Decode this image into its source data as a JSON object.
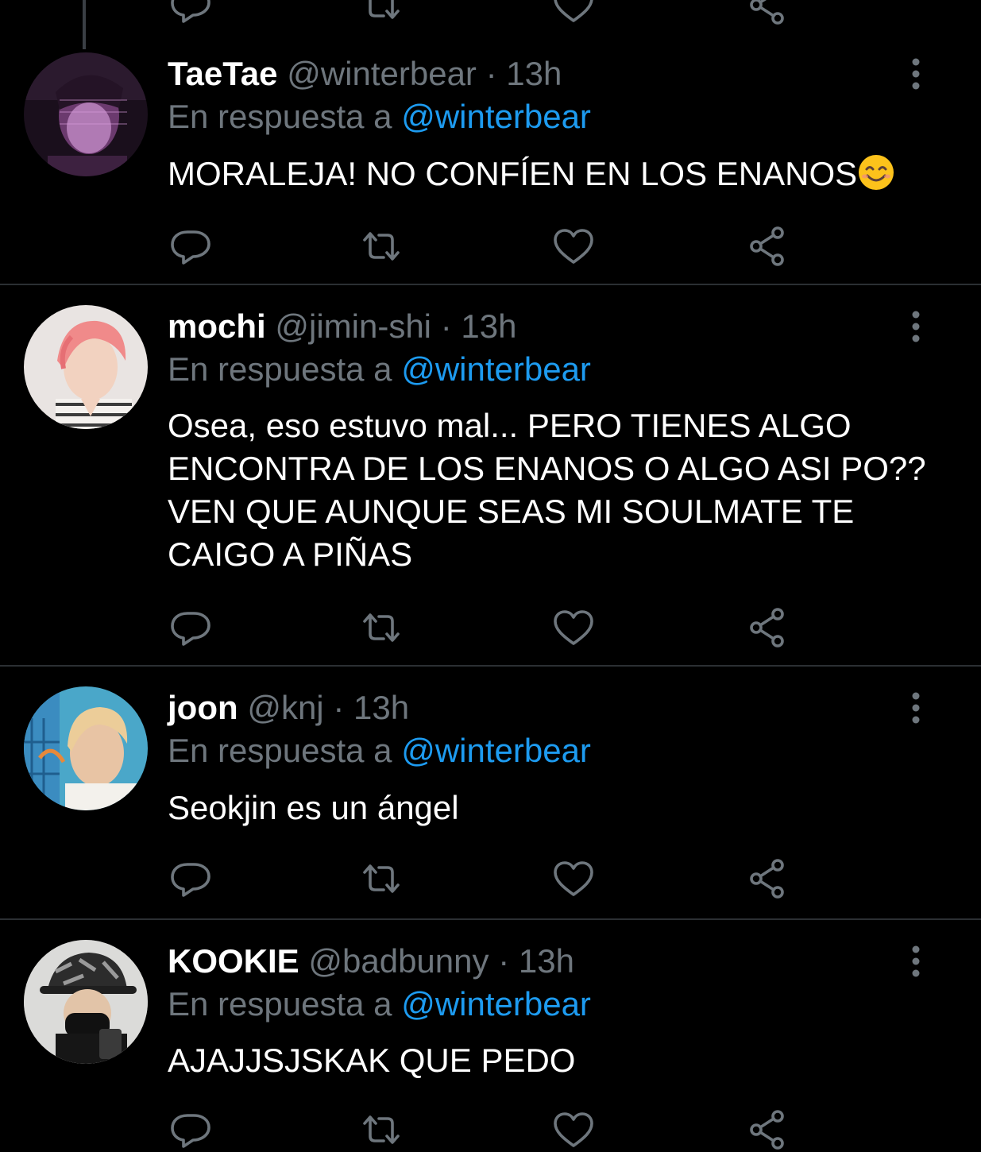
{
  "colors": {
    "background": "#000000",
    "text": "#ffffff",
    "muted": "#6e767d",
    "accent": "#1d9bf0",
    "divider": "#2b2f33"
  },
  "reply_prefix": "En respuesta a",
  "tweets": [
    {
      "display_name": "TaeTae",
      "handle": "@winterbear",
      "separator": "·",
      "time": "13h",
      "reply_to": "@winterbear",
      "text": "MORALEJA! NO CONFÍEN EN LOS ENANOS",
      "emoji": "smiling-face-emoji",
      "avatar": "avatar-purple-portrait"
    },
    {
      "display_name": "mochi",
      "handle": "@jimin-shi",
      "separator": "·",
      "time": "13h",
      "reply_to": "@winterbear",
      "text": "Osea, eso estuvo mal... PERO TIENES ALGO ENCONTRA DE LOS ENANOS O ALGO ASI PO?? VEN QUE AUNQUE SEAS MI SOULMATE TE CAIGO A PIÑAS",
      "avatar": "avatar-pink-hair-portrait"
    },
    {
      "display_name": "joon",
      "handle": "@knj",
      "separator": "·",
      "time": "13h",
      "reply_to": "@winterbear",
      "text": "Seokjin es un ángel",
      "avatar": "avatar-blond-portrait"
    },
    {
      "display_name": "KOOKIE",
      "handle": "@badbunny",
      "separator": "·",
      "time": "13h",
      "reply_to": "@winterbear",
      "text": "AJAJJSJSKAK QUE PEDO",
      "avatar": "avatar-bucket-hat-portrait"
    }
  ],
  "action_icons": [
    "reply-icon",
    "retweet-icon",
    "like-icon",
    "share-icon"
  ]
}
